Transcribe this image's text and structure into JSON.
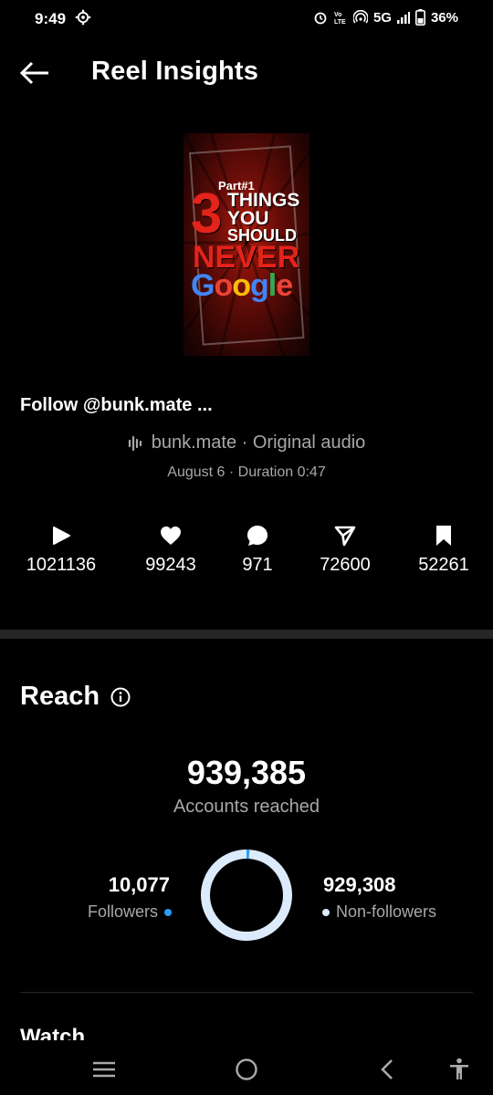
{
  "status_bar": {
    "time": "9:49",
    "network": "5G",
    "battery": "36%"
  },
  "header": {
    "title": "Reel Insights"
  },
  "thumbnail": {
    "part": "Part#1",
    "number": "3",
    "things": "THINGS",
    "you": "YOU",
    "should": "SHOULD",
    "never": "NEVER",
    "google": "Google"
  },
  "reel": {
    "caption": "Follow @bunk.mate ...",
    "audio": "bunk.mate · Original audio",
    "meta": "August 6 · Duration 0:47"
  },
  "stats": {
    "plays": "1021136",
    "likes": "99243",
    "comments": "971",
    "shares": "72600",
    "saves": "52261"
  },
  "reach": {
    "title": "Reach",
    "accounts_reached": "939,385",
    "accounts_reached_label": "Accounts reached",
    "followers_value": "10,077",
    "followers_label": "Followers",
    "non_followers_value": "929,308",
    "non_followers_label": "Non-followers",
    "followers_count": 10077,
    "non_followers_count": 929308
  },
  "colors": {
    "followers": "#2a9df4",
    "non_followers": "#dcebfb",
    "secondary_text": "#a8a8a8"
  },
  "next_section": {
    "title": "Watch"
  }
}
